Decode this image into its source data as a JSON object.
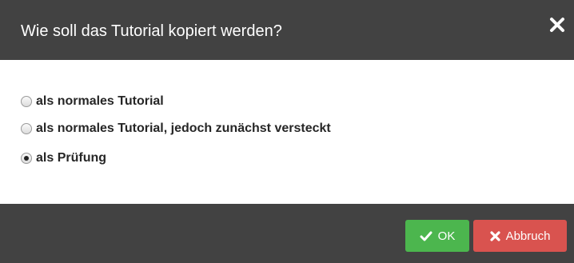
{
  "dialog": {
    "title": "Wie soll das Tutorial kopiert werden?",
    "close_icon": "close-icon"
  },
  "options": [
    {
      "label": "als normales Tutorial",
      "checked": false
    },
    {
      "label": "als normales Tutorial, jedoch zunächst versteckt",
      "checked": false
    },
    {
      "label": "als Prüfung",
      "checked": true
    }
  ],
  "footer": {
    "ok_label": "OK",
    "ok_icon": "check-icon",
    "cancel_label": "Abbruch",
    "cancel_icon": "x-icon"
  },
  "colors": {
    "header_bg": "#424242",
    "ok_button": "#4cb64e",
    "cancel_button": "#d9534f"
  }
}
